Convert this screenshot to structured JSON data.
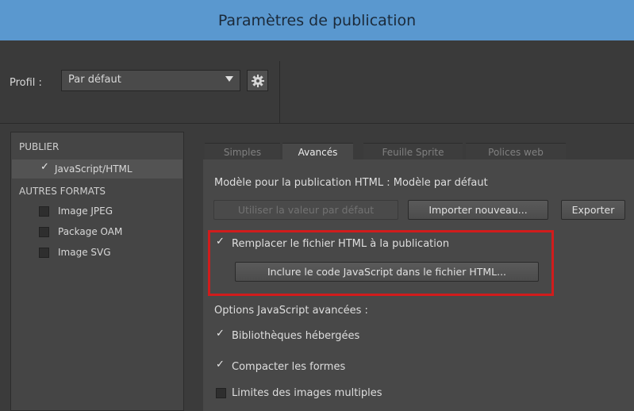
{
  "window": {
    "title": "Paramètres de publication"
  },
  "profile": {
    "label": "Profil :",
    "selected": "Par défaut",
    "settings_icon": "gear-icon"
  },
  "sidebar": {
    "publish_header": "PUBLIER",
    "publish_items": [
      {
        "label": "JavaScript/HTML",
        "checked": true,
        "selected": true
      }
    ],
    "other_header": "AUTRES FORMATS",
    "other_items": [
      {
        "label": "Image JPEG",
        "checked": false
      },
      {
        "label": "Package OAM",
        "checked": false
      },
      {
        "label": "Image SVG",
        "checked": false
      }
    ]
  },
  "tabs": [
    {
      "label": "Simples",
      "active": false
    },
    {
      "label": "Avancés",
      "active": true
    },
    {
      "label": "Feuille Sprite",
      "active": false
    },
    {
      "label": "Polices web",
      "active": false
    }
  ],
  "advanced": {
    "template_line": "Modèle pour la publication HTML : Modèle par défaut",
    "use_default_button": "Utiliser la valeur par défaut",
    "import_button": "Importer nouveau...",
    "export_button": "Exporter",
    "overwrite_html": {
      "label": "Remplacer le fichier HTML à la publication",
      "checked": true
    },
    "include_js_button": "Inclure le code JavaScript dans le fichier HTML...",
    "js_options_header": "Options JavaScript avancées :",
    "hosted_libraries": {
      "label": "Bibliothèques hébergées",
      "checked": true
    },
    "compact_shapes": {
      "label": "Compacter les formes",
      "checked": true
    },
    "multiframe_bounds": {
      "label": "Limites des images multiples",
      "checked": false
    }
  },
  "colors": {
    "titlebar": "#5a98cf",
    "highlight": "#d11c1c",
    "panel": "#484848"
  }
}
